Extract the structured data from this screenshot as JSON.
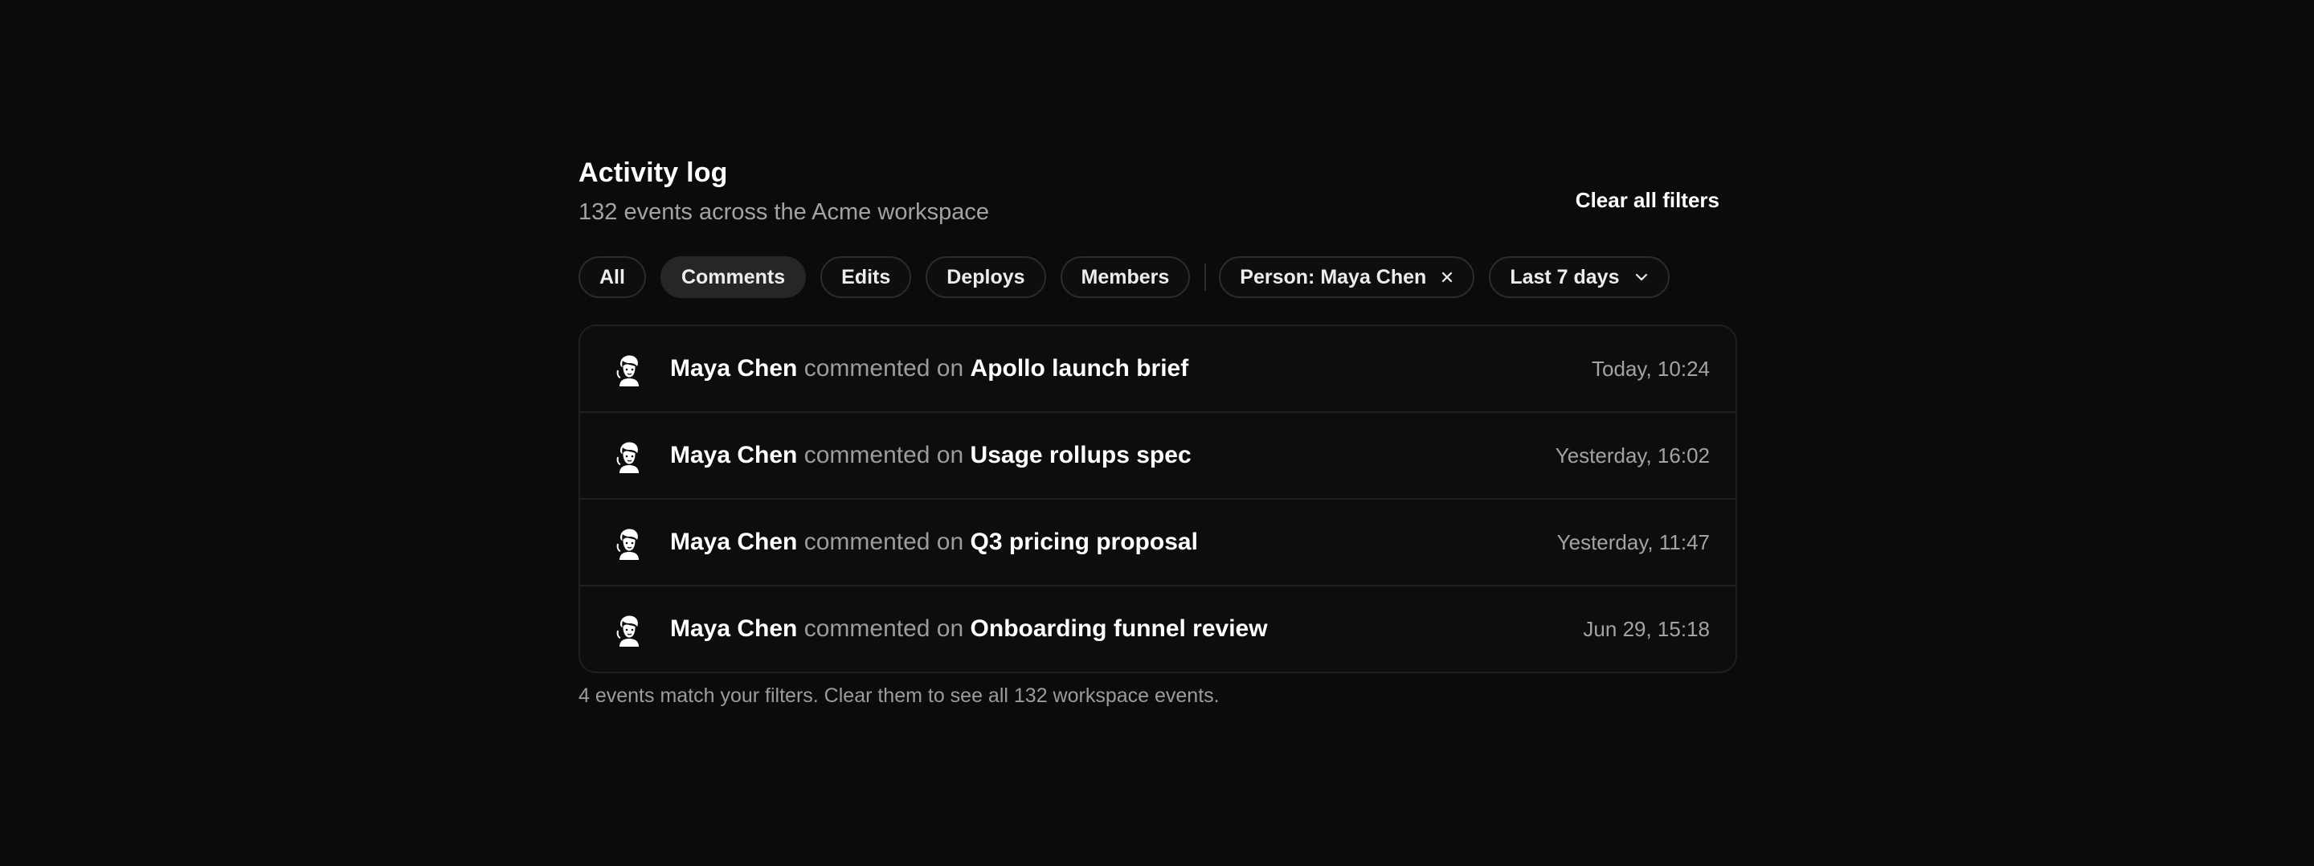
{
  "header": {
    "title": "Activity log",
    "subtitle": "132 events across the Acme workspace",
    "clear_label": "Clear all filters"
  },
  "filters": {
    "types": [
      {
        "label": "All",
        "active": false
      },
      {
        "label": "Comments",
        "active": true
      },
      {
        "label": "Edits",
        "active": false
      },
      {
        "label": "Deploys",
        "active": false
      },
      {
        "label": "Members",
        "active": false
      }
    ],
    "person_chip": {
      "label": "Person: Maya Chen",
      "icon": "close-icon"
    },
    "date_chip": {
      "label": "Last 7 days",
      "icon": "chevron-down-icon"
    }
  },
  "events": [
    {
      "actor": "Maya Chen",
      "verb": "commented on",
      "target": "Apollo launch brief",
      "time": "Today, 10:24",
      "avatar_icon": "avatar-icon"
    },
    {
      "actor": "Maya Chen",
      "verb": "commented on",
      "target": "Usage rollups spec",
      "time": "Yesterday, 16:02",
      "avatar_icon": "avatar-icon"
    },
    {
      "actor": "Maya Chen",
      "verb": "commented on",
      "target": "Q3 pricing proposal",
      "time": "Yesterday, 11:47",
      "avatar_icon": "avatar-icon"
    },
    {
      "actor": "Maya Chen",
      "verb": "commented on",
      "target": "Onboarding funnel review",
      "time": "Jun 29, 15:18",
      "avatar_icon": "avatar-icon"
    }
  ],
  "footer": {
    "note": "4 events match your filters. Clear them to see all 132 workspace events."
  },
  "colors": {
    "background": "#0b0b0b",
    "active_chip": "#262626",
    "muted_text": "#a3a3a3"
  }
}
